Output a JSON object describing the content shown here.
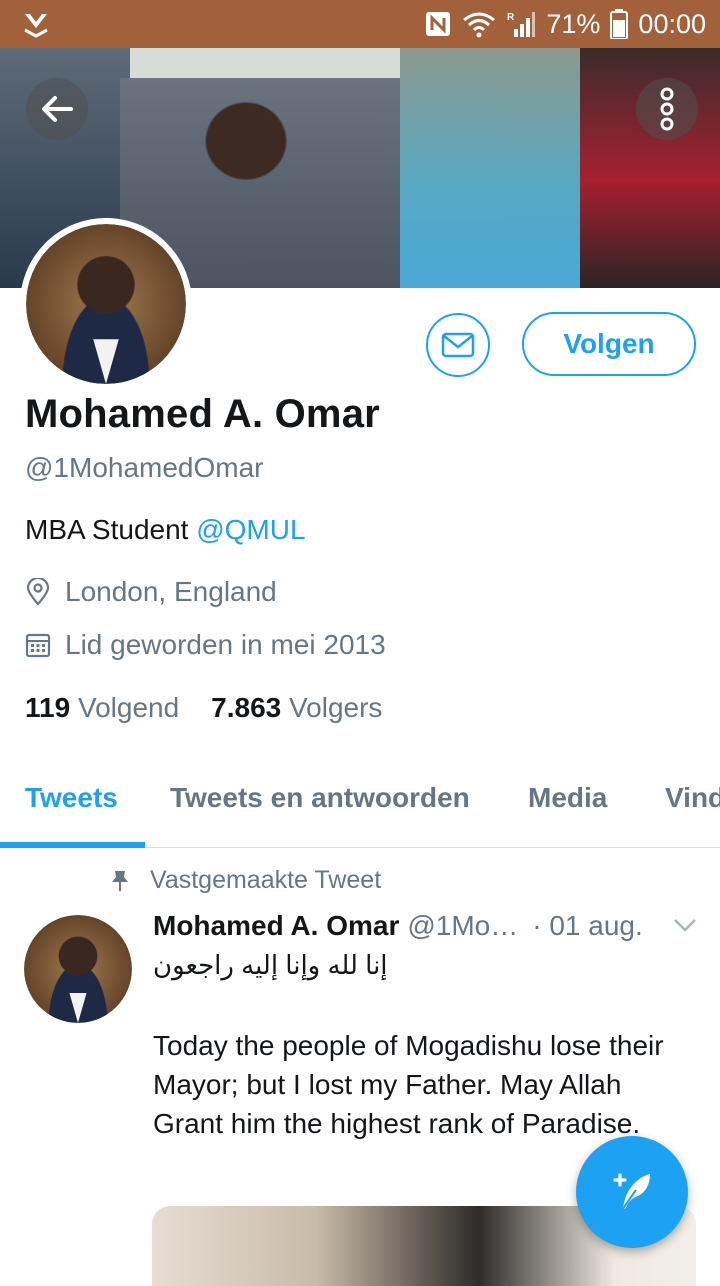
{
  "status_bar": {
    "battery": "71%",
    "time": "00:00",
    "signal_roaming": "R"
  },
  "profile": {
    "name": "Mohamed A. Omar",
    "handle": "@1MohamedOmar",
    "bio_text": "MBA Student ",
    "bio_mention": "@QMUL",
    "location": "London, England",
    "joined": "Lid geworden in mei 2013",
    "following_count": "119",
    "following_label": "Volgend",
    "followers_count": "7.863",
    "followers_label": "Volgers",
    "follow_button": "Volgen"
  },
  "tabs": [
    {
      "label": "Tweets",
      "active": true
    },
    {
      "label": "Tweets en antwoorden",
      "active": false
    },
    {
      "label": "Media",
      "active": false
    },
    {
      "label": "Vind",
      "active": false
    }
  ],
  "pinned_tweet": {
    "pinned_label": "Vastgemaakte Tweet",
    "author_name": "Mohamed A. Omar",
    "author_handle": "@1Mo…",
    "date": "· 01 aug.",
    "arabic_line": "إنا لله وإنا إليه راجعون",
    "body": "Today the people of Mogadishu lose their Mayor; but I lost my Father. May Allah Grant him the highest rank of Paradise."
  },
  "colors": {
    "status_bar": "#a2613a",
    "accent": "#1da1f2",
    "secondary_text": "#657786",
    "primary_text": "#14171a"
  },
  "icons": [
    "back-arrow-icon",
    "more-vertical-icon",
    "mail-icon",
    "location-pin-icon",
    "calendar-icon",
    "pin-icon",
    "chevron-down-icon",
    "compose-feather-icon",
    "nfc-icon",
    "wifi-icon",
    "cell-signal-icon",
    "battery-icon",
    "app-notification-icon"
  ]
}
